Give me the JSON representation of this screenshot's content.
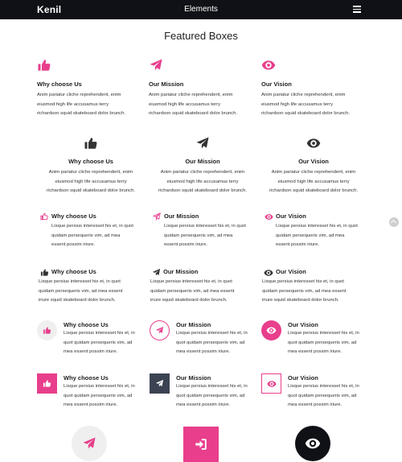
{
  "header": {
    "brand": "Kenil",
    "title": "Elements",
    "menu_icon": "hamburger-icon"
  },
  "section": {
    "title": "Featured Boxes"
  },
  "colors": {
    "accent": "#e83e8c",
    "dark": "#333333",
    "navbar": "#101116",
    "light_circle": "#efefef"
  },
  "boxes": [
    {
      "title": "Why choose Us",
      "text": [
        "Anim pariatur cliche reprehenderit, enim",
        "eiusmod high life accusamus terry",
        "richardson squid skateboard dolor brunch."
      ],
      "icon": "thumbs-up-icon"
    },
    {
      "title": "Our Mission",
      "text": [
        "Anim pariatur cliche reprehenderit, enim",
        "eiusmod high life accusamus terry",
        "richardson squid skateboard dolor brunch."
      ],
      "icon": "paper-plane-icon"
    },
    {
      "title": "Our Vision",
      "text": [
        "Anim pariatur cliche reprehenderit, enim",
        "eiusmod high life accusamus terry",
        "richardson squid skateboard dolor brunch."
      ],
      "icon": "eye-icon"
    },
    {
      "title": "Why choose Us",
      "text": [
        "Anim pariatur cliche reprehenderit, enim",
        "eiusmod high life accusamus terry",
        "richardson squid skateboard dolor brunch."
      ],
      "icon": "thumbs-up-icon"
    },
    {
      "title": "Our Mission",
      "text": [
        "Anim pariatur cliche reprehenderit, enim",
        "eiusmod high life accusamus terry",
        "richardson squid skateboard dolor brunch."
      ],
      "icon": "paper-plane-icon"
    },
    {
      "title": "Our Vision",
      "text": [
        "Anim pariatur cliche reprehenderit, enim",
        "eiusmod high life accusamus terry",
        "richardson squid skateboard dolor brunch."
      ],
      "icon": "eye-icon"
    },
    {
      "title": "Why choose Us",
      "text": [
        "Lisque persius interesset his et, in quot",
        "quidam persequeris vim, ad mea",
        "essent possim iriure."
      ],
      "icon": "thumbs-up-icon"
    },
    {
      "title": "Our Mission",
      "text": [
        "Lisque persius interesset his et, in quot",
        "quidam persequeris vim, ad mea",
        "essent possim iriure."
      ],
      "icon": "paper-plane-icon"
    },
    {
      "title": "Our Vision",
      "text": [
        "Lisque persius interesset his et, in quot",
        "quidam persequeris vim, ad mea",
        "essent possim iriure."
      ],
      "icon": "eye-icon"
    },
    {
      "title": "Why choose Us",
      "text": [
        "Lisque persius interesset his et, in quot",
        "quidam persequeris vim, ad mea essent",
        "iriure squid skateboard dolor brunch."
      ],
      "icon": "thumbs-up-icon"
    },
    {
      "title": "Our Mission",
      "text": [
        "Lisque persius interesset his et, in quot",
        "quidam persequeris vim, ad mea essent",
        "iriure squid skateboard dolor brunch."
      ],
      "icon": "paper-plane-icon"
    },
    {
      "title": "Our Vision",
      "text": [
        "Lisque persius interesset his et, in quot",
        "quidam persequeris vim, ad mea essent",
        "iriure squid skateboard dolor brunch."
      ],
      "icon": "eye-icon"
    },
    {
      "title": "Why choose Us",
      "text": [
        "Lisque persius interesset his et, in",
        "quot quidam persequeris vim, ad",
        "mea essent possim iriure."
      ],
      "icon": "thumbs-up-icon"
    },
    {
      "title": "Our Mission",
      "text": [
        "Lisque persius interesset his et, in",
        "quot quidam persequeris vim, ad",
        "mea essent possim iriure."
      ],
      "icon": "paper-plane-icon"
    },
    {
      "title": "Our Vision",
      "text": [
        "Lisque persius interesset his et, in",
        "quot quidam persequeris vim, ad",
        "mea essent possim iriure."
      ],
      "icon": "eye-icon"
    },
    {
      "title": "Why choose Us",
      "text": [
        "Lisque persius interesset his et, in",
        "quot quidam persequeris vim, ad",
        "mea essent possim iriure."
      ],
      "icon": "thumbs-up-icon"
    },
    {
      "title": "Our Mission",
      "text": [
        "Lisque persius interesset his et, in",
        "quot quidam persequeris vim, ad",
        "mea essent possim iriure."
      ],
      "icon": "paper-plane-icon"
    },
    {
      "title": "Our Vision",
      "text": [
        "Lisque persius interesset his et, in",
        "quot quidam persequeris vim, ad",
        "mea essent possim iriure."
      ],
      "icon": "eye-icon"
    }
  ],
  "bottom_icons": [
    {
      "icon": "paper-plane-icon"
    },
    {
      "icon": "sign-in-icon"
    },
    {
      "icon": "eye-icon"
    }
  ]
}
